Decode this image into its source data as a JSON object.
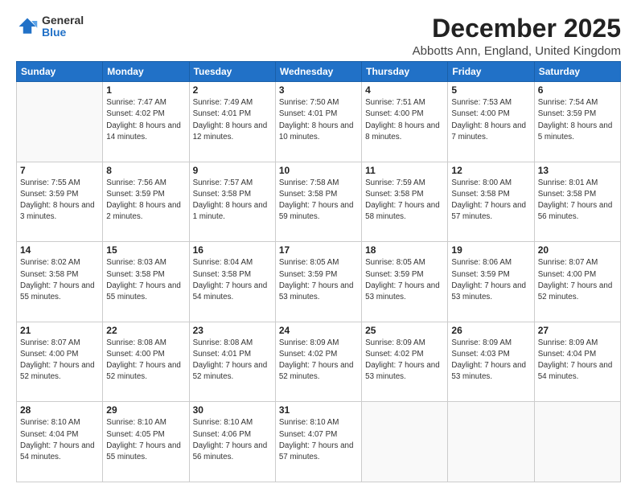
{
  "logo": {
    "general": "General",
    "blue": "Blue"
  },
  "title": {
    "month_year": "December 2025",
    "location": "Abbotts Ann, England, United Kingdom"
  },
  "weekdays": [
    "Sunday",
    "Monday",
    "Tuesday",
    "Wednesday",
    "Thursday",
    "Friday",
    "Saturday"
  ],
  "weeks": [
    [
      {
        "day": "",
        "sunrise": "",
        "sunset": "",
        "daylight": ""
      },
      {
        "day": "1",
        "sunrise": "Sunrise: 7:47 AM",
        "sunset": "Sunset: 4:02 PM",
        "daylight": "Daylight: 8 hours and 14 minutes."
      },
      {
        "day": "2",
        "sunrise": "Sunrise: 7:49 AM",
        "sunset": "Sunset: 4:01 PM",
        "daylight": "Daylight: 8 hours and 12 minutes."
      },
      {
        "day": "3",
        "sunrise": "Sunrise: 7:50 AM",
        "sunset": "Sunset: 4:01 PM",
        "daylight": "Daylight: 8 hours and 10 minutes."
      },
      {
        "day": "4",
        "sunrise": "Sunrise: 7:51 AM",
        "sunset": "Sunset: 4:00 PM",
        "daylight": "Daylight: 8 hours and 8 minutes."
      },
      {
        "day": "5",
        "sunrise": "Sunrise: 7:53 AM",
        "sunset": "Sunset: 4:00 PM",
        "daylight": "Daylight: 8 hours and 7 minutes."
      },
      {
        "day": "6",
        "sunrise": "Sunrise: 7:54 AM",
        "sunset": "Sunset: 3:59 PM",
        "daylight": "Daylight: 8 hours and 5 minutes."
      }
    ],
    [
      {
        "day": "7",
        "sunrise": "Sunrise: 7:55 AM",
        "sunset": "Sunset: 3:59 PM",
        "daylight": "Daylight: 8 hours and 3 minutes."
      },
      {
        "day": "8",
        "sunrise": "Sunrise: 7:56 AM",
        "sunset": "Sunset: 3:59 PM",
        "daylight": "Daylight: 8 hours and 2 minutes."
      },
      {
        "day": "9",
        "sunrise": "Sunrise: 7:57 AM",
        "sunset": "Sunset: 3:58 PM",
        "daylight": "Daylight: 8 hours and 1 minute."
      },
      {
        "day": "10",
        "sunrise": "Sunrise: 7:58 AM",
        "sunset": "Sunset: 3:58 PM",
        "daylight": "Daylight: 7 hours and 59 minutes."
      },
      {
        "day": "11",
        "sunrise": "Sunrise: 7:59 AM",
        "sunset": "Sunset: 3:58 PM",
        "daylight": "Daylight: 7 hours and 58 minutes."
      },
      {
        "day": "12",
        "sunrise": "Sunrise: 8:00 AM",
        "sunset": "Sunset: 3:58 PM",
        "daylight": "Daylight: 7 hours and 57 minutes."
      },
      {
        "day": "13",
        "sunrise": "Sunrise: 8:01 AM",
        "sunset": "Sunset: 3:58 PM",
        "daylight": "Daylight: 7 hours and 56 minutes."
      }
    ],
    [
      {
        "day": "14",
        "sunrise": "Sunrise: 8:02 AM",
        "sunset": "Sunset: 3:58 PM",
        "daylight": "Daylight: 7 hours and 55 minutes."
      },
      {
        "day": "15",
        "sunrise": "Sunrise: 8:03 AM",
        "sunset": "Sunset: 3:58 PM",
        "daylight": "Daylight: 7 hours and 55 minutes."
      },
      {
        "day": "16",
        "sunrise": "Sunrise: 8:04 AM",
        "sunset": "Sunset: 3:58 PM",
        "daylight": "Daylight: 7 hours and 54 minutes."
      },
      {
        "day": "17",
        "sunrise": "Sunrise: 8:05 AM",
        "sunset": "Sunset: 3:59 PM",
        "daylight": "Daylight: 7 hours and 53 minutes."
      },
      {
        "day": "18",
        "sunrise": "Sunrise: 8:05 AM",
        "sunset": "Sunset: 3:59 PM",
        "daylight": "Daylight: 7 hours and 53 minutes."
      },
      {
        "day": "19",
        "sunrise": "Sunrise: 8:06 AM",
        "sunset": "Sunset: 3:59 PM",
        "daylight": "Daylight: 7 hours and 53 minutes."
      },
      {
        "day": "20",
        "sunrise": "Sunrise: 8:07 AM",
        "sunset": "Sunset: 4:00 PM",
        "daylight": "Daylight: 7 hours and 52 minutes."
      }
    ],
    [
      {
        "day": "21",
        "sunrise": "Sunrise: 8:07 AM",
        "sunset": "Sunset: 4:00 PM",
        "daylight": "Daylight: 7 hours and 52 minutes."
      },
      {
        "day": "22",
        "sunrise": "Sunrise: 8:08 AM",
        "sunset": "Sunset: 4:00 PM",
        "daylight": "Daylight: 7 hours and 52 minutes."
      },
      {
        "day": "23",
        "sunrise": "Sunrise: 8:08 AM",
        "sunset": "Sunset: 4:01 PM",
        "daylight": "Daylight: 7 hours and 52 minutes."
      },
      {
        "day": "24",
        "sunrise": "Sunrise: 8:09 AM",
        "sunset": "Sunset: 4:02 PM",
        "daylight": "Daylight: 7 hours and 52 minutes."
      },
      {
        "day": "25",
        "sunrise": "Sunrise: 8:09 AM",
        "sunset": "Sunset: 4:02 PM",
        "daylight": "Daylight: 7 hours and 53 minutes."
      },
      {
        "day": "26",
        "sunrise": "Sunrise: 8:09 AM",
        "sunset": "Sunset: 4:03 PM",
        "daylight": "Daylight: 7 hours and 53 minutes."
      },
      {
        "day": "27",
        "sunrise": "Sunrise: 8:09 AM",
        "sunset": "Sunset: 4:04 PM",
        "daylight": "Daylight: 7 hours and 54 minutes."
      }
    ],
    [
      {
        "day": "28",
        "sunrise": "Sunrise: 8:10 AM",
        "sunset": "Sunset: 4:04 PM",
        "daylight": "Daylight: 7 hours and 54 minutes."
      },
      {
        "day": "29",
        "sunrise": "Sunrise: 8:10 AM",
        "sunset": "Sunset: 4:05 PM",
        "daylight": "Daylight: 7 hours and 55 minutes."
      },
      {
        "day": "30",
        "sunrise": "Sunrise: 8:10 AM",
        "sunset": "Sunset: 4:06 PM",
        "daylight": "Daylight: 7 hours and 56 minutes."
      },
      {
        "day": "31",
        "sunrise": "Sunrise: 8:10 AM",
        "sunset": "Sunset: 4:07 PM",
        "daylight": "Daylight: 7 hours and 57 minutes."
      },
      {
        "day": "",
        "sunrise": "",
        "sunset": "",
        "daylight": ""
      },
      {
        "day": "",
        "sunrise": "",
        "sunset": "",
        "daylight": ""
      },
      {
        "day": "",
        "sunrise": "",
        "sunset": "",
        "daylight": ""
      }
    ]
  ]
}
